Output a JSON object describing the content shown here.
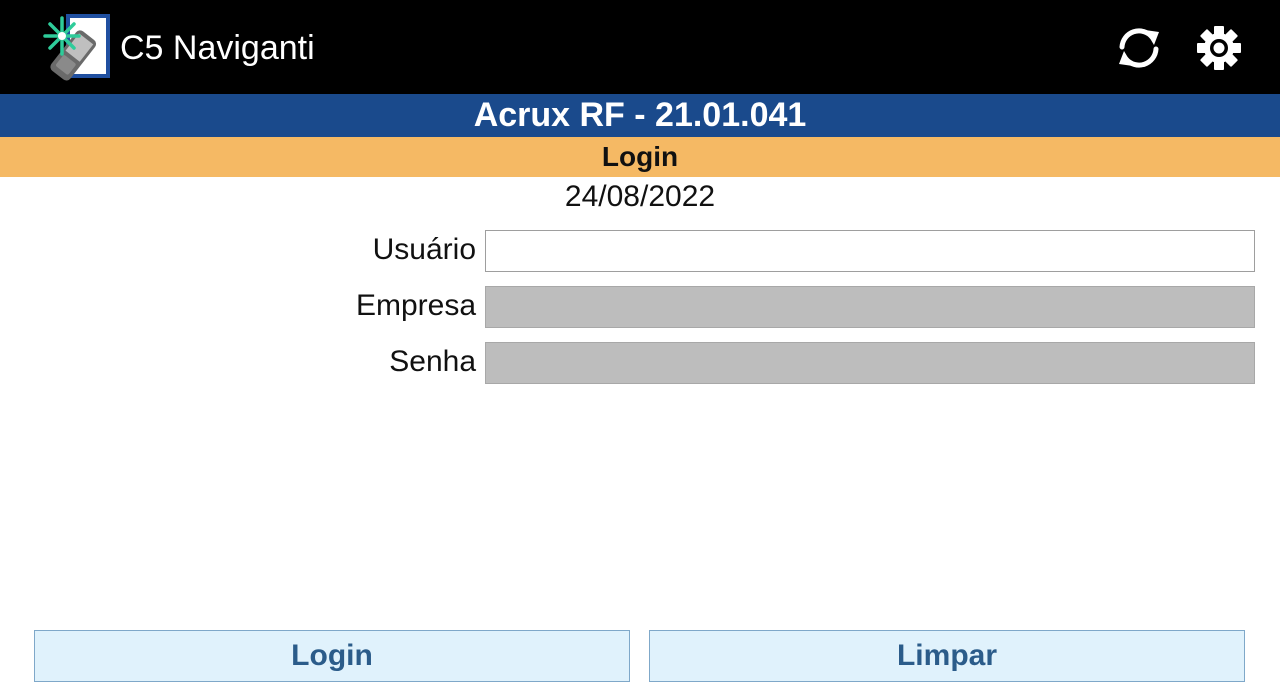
{
  "app": {
    "title": "C5 Naviganti",
    "logo_icon": "handheld-scanner-icon",
    "actions": [
      {
        "name": "sync",
        "icon": "sync-icon"
      },
      {
        "name": "settings",
        "icon": "gear-icon"
      }
    ]
  },
  "header": {
    "version": "Acrux RF - 21.01.041",
    "screen_title": "Login",
    "date": "24/08/2022"
  },
  "form": {
    "fields": [
      {
        "label": "Usuário",
        "value": "",
        "enabled": true
      },
      {
        "label": "Empresa",
        "value": "",
        "enabled": false
      },
      {
        "label": "Senha",
        "value": "",
        "enabled": false
      }
    ]
  },
  "buttons": {
    "login_label": "Login",
    "clear_label": "Limpar"
  },
  "colors": {
    "appbar": "#000000",
    "version_bar": "#1a4a8c",
    "screen_bar": "#f5b964",
    "button_bg": "#e0f2fc",
    "button_text": "#2b5c8a",
    "disabled_field": "#bdbdbd"
  }
}
